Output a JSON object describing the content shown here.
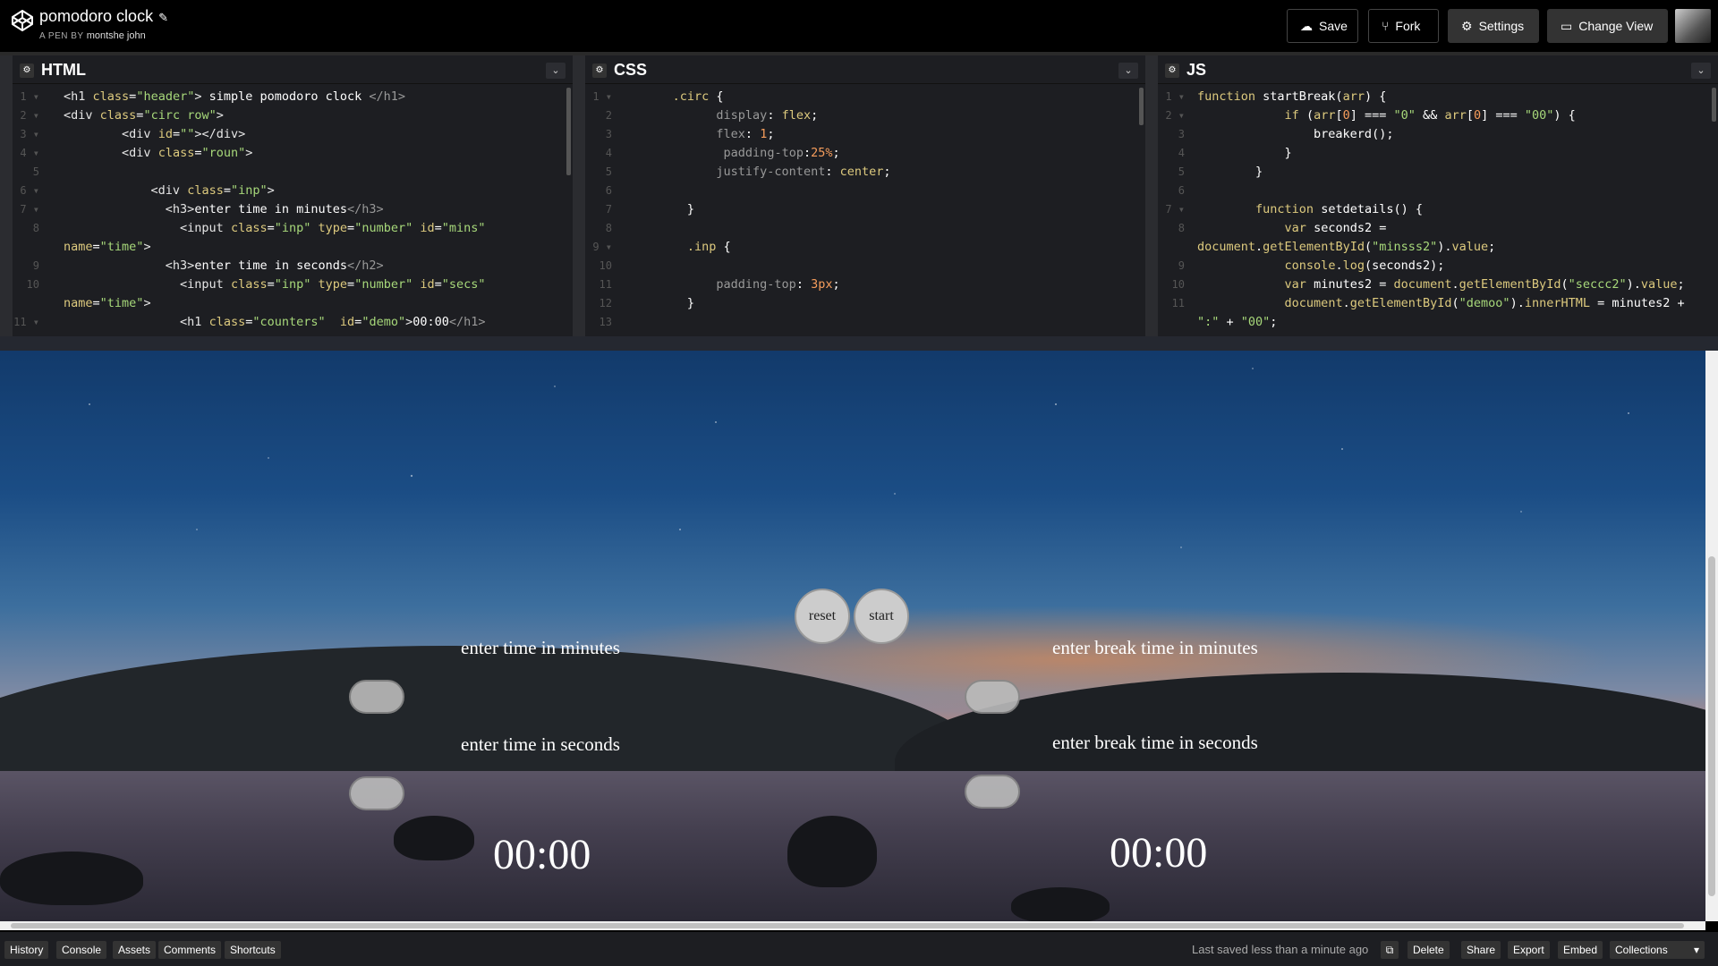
{
  "header": {
    "title": "pomodoro clock",
    "byline_prefix": "A PEN BY",
    "author": "montshe john",
    "save_label": "Save",
    "fork_label": "Fork",
    "settings_label": "Settings",
    "change_view_label": "Change View"
  },
  "panes": {
    "html_title": "HTML",
    "css_title": "CSS",
    "js_title": "JS"
  },
  "preview": {
    "reset_label": "reset",
    "start_label": "start",
    "label_minutes": "enter time in minutes",
    "label_seconds": "enter time in seconds",
    "label_break_minutes": "enter break time in minutes",
    "label_break_seconds": "enter break time in seconds",
    "counter_left": "00:00",
    "counter_right": "00:00"
  },
  "footer": {
    "history": "History",
    "console": "Console",
    "assets": "Assets",
    "comments": "Comments",
    "shortcuts": "Shortcuts",
    "saved_text": "Last saved less than a minute ago",
    "delete": "Delete",
    "share": "Share",
    "export": "Export",
    "embed": "Embed",
    "collections": "Collections"
  },
  "colors": {
    "accent_grey": "#333333",
    "editor_bg": "#1d1e22",
    "string": "#a7d87a",
    "attribute": "#ddca7e"
  }
}
